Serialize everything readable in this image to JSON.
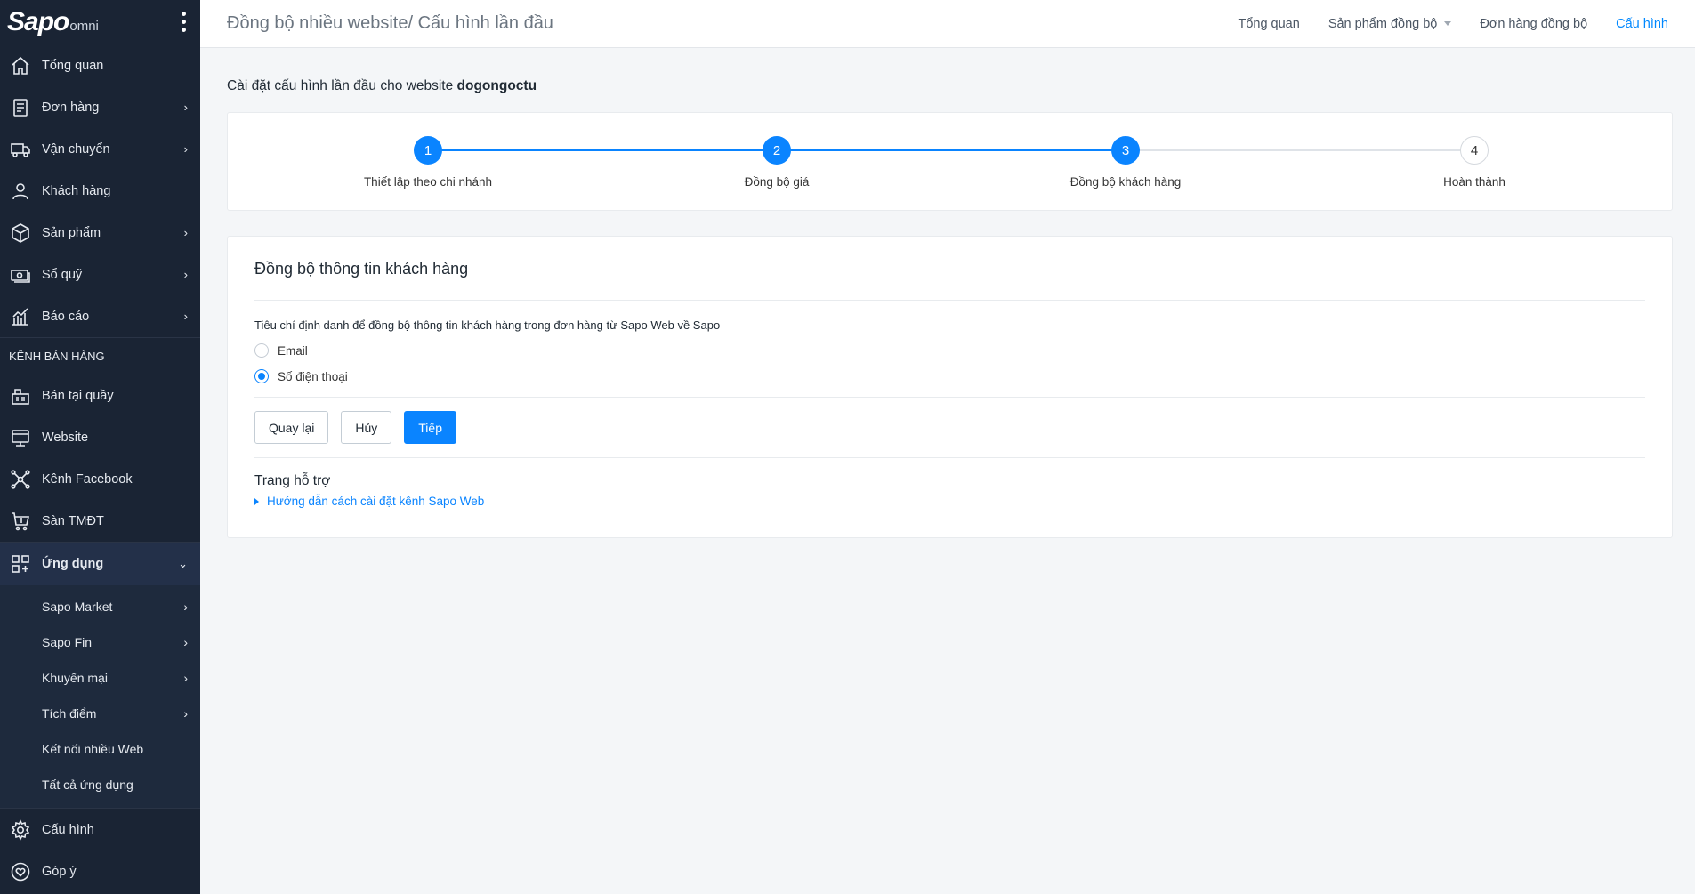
{
  "app": {
    "logo_main": "Sapo",
    "logo_sub": "omni"
  },
  "sidebar": {
    "items": [
      {
        "label": "Tổng quan",
        "chevron": ""
      },
      {
        "label": "Đơn hàng",
        "chevron": "›"
      },
      {
        "label": "Vận chuyển",
        "chevron": "›"
      },
      {
        "label": "Khách hàng",
        "chevron": ""
      },
      {
        "label": "Sản phẩm",
        "chevron": "›"
      },
      {
        "label": "Sổ quỹ",
        "chevron": "›"
      },
      {
        "label": "Báo cáo",
        "chevron": "›"
      }
    ],
    "channels_label": "KÊNH BÁN HÀNG",
    "channels": [
      {
        "label": "Bán tại quầy"
      },
      {
        "label": "Website"
      },
      {
        "label": "Kênh Facebook"
      },
      {
        "label": "Sàn TMĐT"
      }
    ],
    "apps": {
      "label": "Ứng dụng",
      "chevron": "⌄"
    },
    "app_subitems": [
      {
        "label": "Sapo Market",
        "chevron": "›"
      },
      {
        "label": "Sapo Fin",
        "chevron": "›"
      },
      {
        "label": "Khuyến mại",
        "chevron": "›"
      },
      {
        "label": "Tích điểm",
        "chevron": "›"
      },
      {
        "label": "Kết nối nhiều Web",
        "chevron": ""
      },
      {
        "label": "Tất cả ứng dụng",
        "chevron": ""
      }
    ],
    "bottom": [
      {
        "label": "Cấu hình"
      },
      {
        "label": "Góp ý"
      }
    ]
  },
  "header": {
    "title": "Đồng bộ nhiều website/ Cấu hình lần đầu",
    "nav": [
      {
        "label": "Tổng quan"
      },
      {
        "label": "Sản phẩm đồng bộ"
      },
      {
        "label": "Đơn hàng đồng bộ"
      },
      {
        "label": "Cấu hình"
      }
    ],
    "active_color": "#0088ff"
  },
  "main": {
    "heading_prefix": "Cài đặt cấu hình lần đầu cho website",
    "heading_site": "dogongoctu",
    "steps": [
      {
        "num": "1",
        "label": "Thiết lập theo chi nhánh",
        "done": true
      },
      {
        "num": "2",
        "label": "Đồng bộ giá",
        "done": true
      },
      {
        "num": "3",
        "label": "Đồng bộ khách hàng",
        "done": true
      },
      {
        "num": "4",
        "label": "Hoàn thành",
        "done": false
      }
    ],
    "current_step": 3,
    "form": {
      "title": "Đồng bộ thông tin khách hàng",
      "criteria": "Tiêu chí định danh để đồng bộ thông tin khách hàng trong đơn hàng từ Sapo Web về Sapo",
      "options": [
        {
          "label": "Email",
          "checked": false
        },
        {
          "label": "Số điện thoại",
          "checked": true
        }
      ],
      "buttons": {
        "back": "Quay lại",
        "cancel": "Hủy",
        "next": "Tiếp"
      }
    },
    "help": {
      "title": "Trang hỗ trợ",
      "link": "Hướng dẫn cách cài đặt kênh Sapo Web"
    },
    "accent": "#0a84ff"
  }
}
